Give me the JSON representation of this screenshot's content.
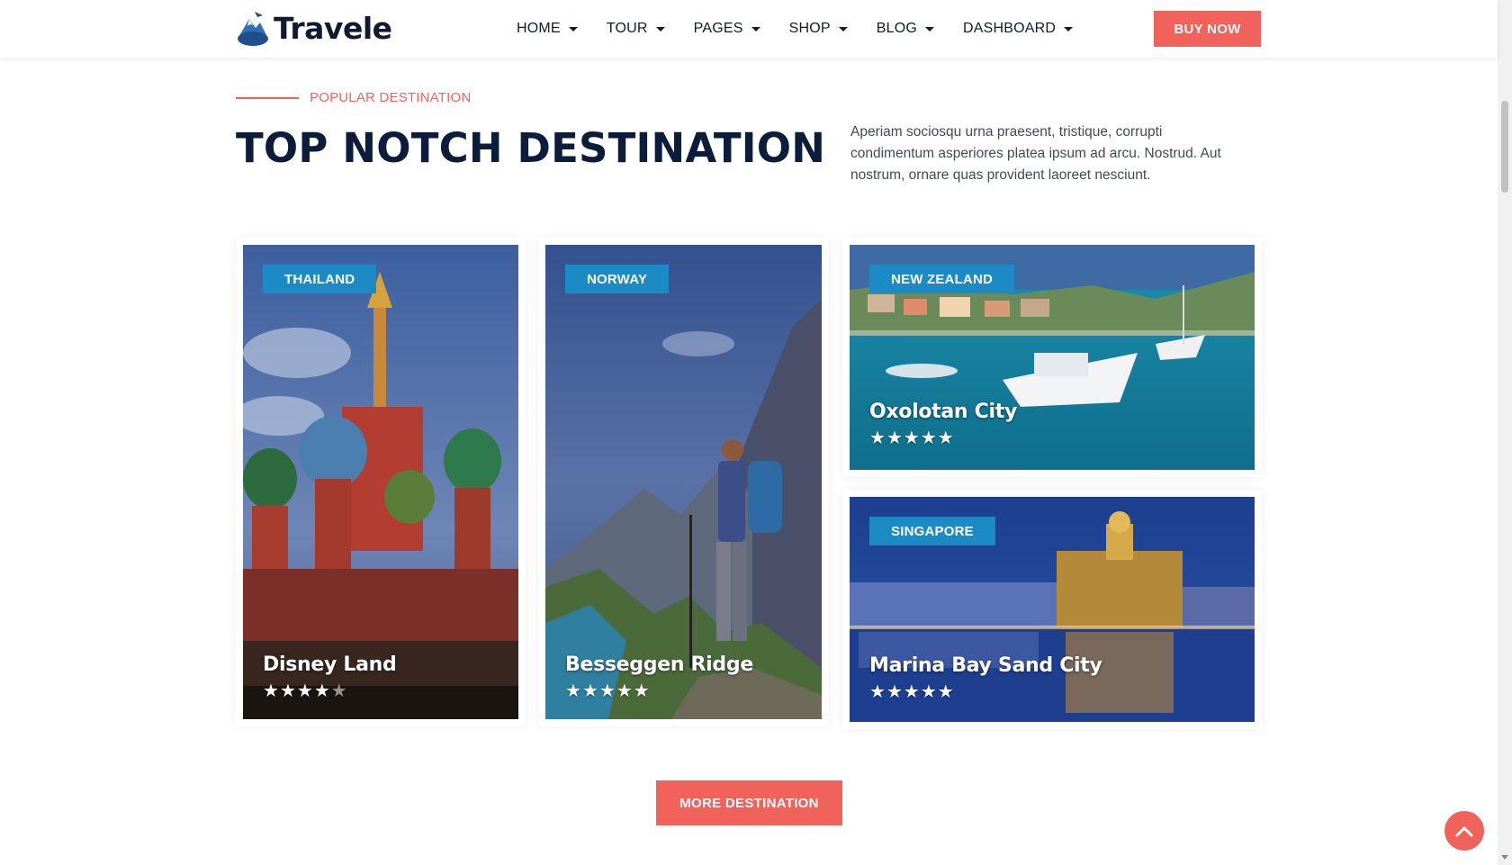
{
  "brand": {
    "name": "Travele"
  },
  "nav": {
    "items": [
      {
        "label": "HOME"
      },
      {
        "label": "TOUR"
      },
      {
        "label": "PAGES"
      },
      {
        "label": "SHOP"
      },
      {
        "label": "BLOG"
      },
      {
        "label": "DASHBOARD"
      }
    ],
    "buy_label": "BUY NOW"
  },
  "section": {
    "eyebrow": "POPULAR DESTINATION",
    "title": "TOP NOTCH DESTINATION",
    "description": "Aperiam sociosqu urna praesent, tristique, corrupti condimentum asperiores platea ipsum ad arcu. Nostrud. Aut nostrum, ornare quas provident laoreet nesciunt."
  },
  "destinations": [
    {
      "country": "THAILAND",
      "name": "Disney Land",
      "rating": 4.5
    },
    {
      "country": "NORWAY",
      "name": "Besseggen Ridge",
      "rating": 5
    },
    {
      "country": "NEW ZEALAND",
      "name": "Oxolotan City",
      "rating": 5
    },
    {
      "country": "SINGAPORE",
      "name": "Marina Bay Sand City",
      "rating": 5
    }
  ],
  "more_label": "MORE DESTINATION",
  "colors": {
    "accent": "#f0625a",
    "tag": "#1c8ac4",
    "heading": "#0b1d3a"
  },
  "icons": {
    "back_to_top": "chevron-up-icon",
    "nav_caret": "caret-down-icon",
    "rating": "star-icon"
  }
}
